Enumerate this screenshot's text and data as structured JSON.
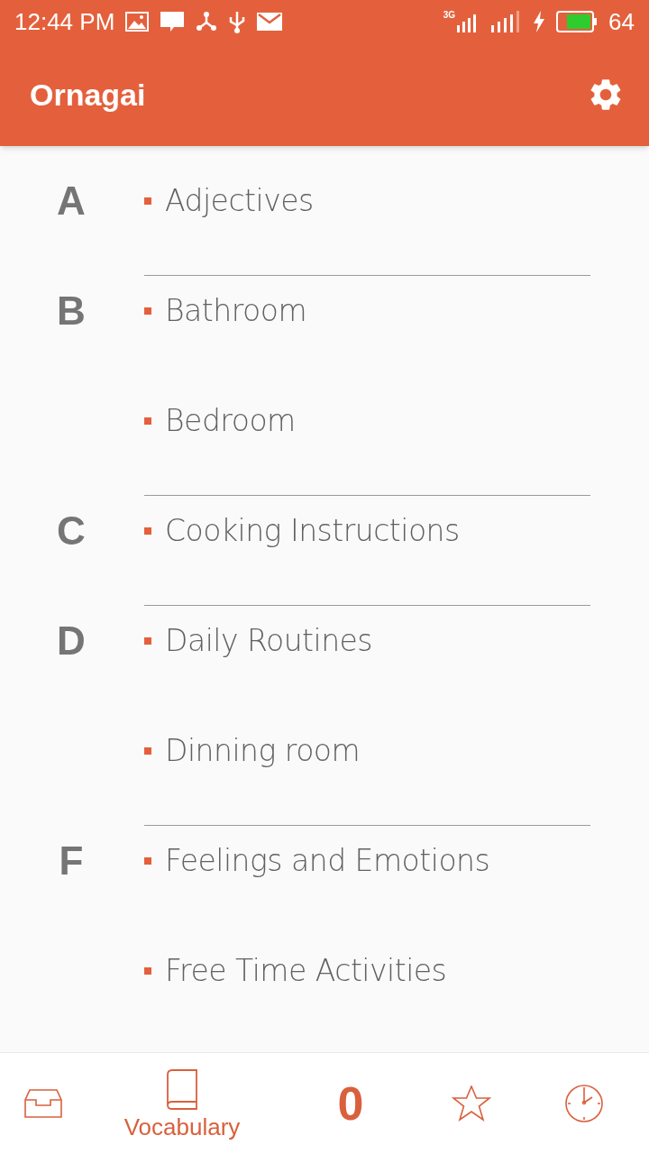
{
  "status_bar": {
    "time": "12:44 PM",
    "network": "3G",
    "battery": "64"
  },
  "app_bar": {
    "title": "Ornagai"
  },
  "sections": [
    {
      "letter": "A",
      "items": [
        "Adjectives"
      ]
    },
    {
      "letter": "B",
      "items": [
        "Bathroom",
        "Bedroom"
      ]
    },
    {
      "letter": "C",
      "items": [
        "Cooking Instructions"
      ]
    },
    {
      "letter": "D",
      "items": [
        "Daily Routines",
        "Dinning room"
      ]
    },
    {
      "letter": "F",
      "items": [
        "Feelings and Emotions",
        "Free Time Activities"
      ]
    }
  ],
  "bottom_nav": [
    {
      "kind": "inbox"
    },
    {
      "kind": "book",
      "label": "Vocabulary"
    },
    {
      "kind": "count",
      "label": "0"
    },
    {
      "kind": "star"
    },
    {
      "kind": "clock"
    }
  ]
}
